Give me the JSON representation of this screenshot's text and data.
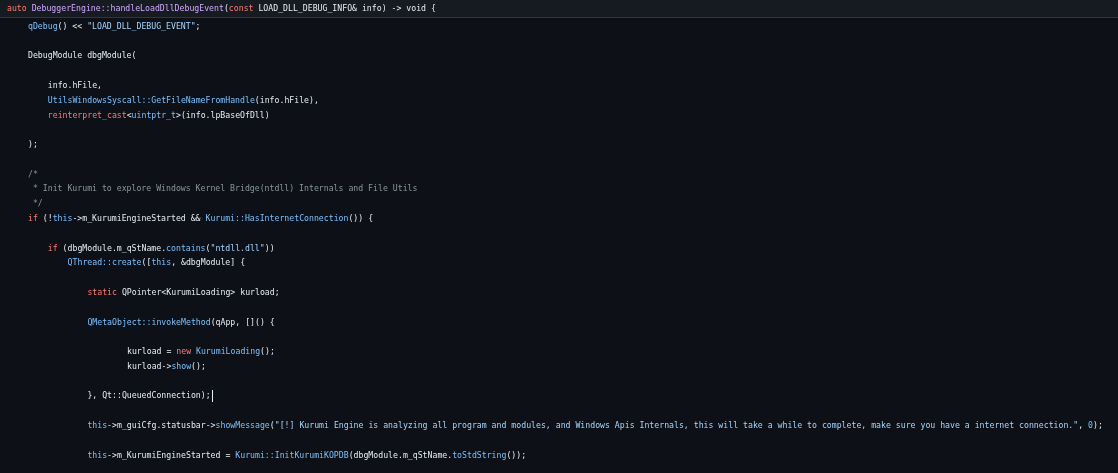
{
  "editor": {
    "header": {
      "tokens": [
        {
          "kind": "keyword",
          "text": "auto "
        },
        {
          "kind": "type",
          "text": "DebuggerEngine::handleLoadDllDebugEvent"
        },
        {
          "kind": "plain",
          "text": "("
        },
        {
          "kind": "keyword",
          "text": "const "
        },
        {
          "kind": "plain",
          "text": "LOAD_DLL_DEBUG_INFO& info) -> void {"
        }
      ]
    },
    "lines": [
      {
        "kind": "code",
        "tokens": [
          {
            "kind": "function",
            "text": "qDebug"
          },
          {
            "kind": "plain",
            "text": "() << "
          },
          {
            "kind": "string",
            "text": "\"LOAD_DLL_DEBUG_EVENT\""
          },
          {
            "kind": "plain",
            "text": ";"
          }
        ]
      },
      {
        "kind": "blank"
      },
      {
        "kind": "code",
        "tokens": [
          {
            "kind": "plain",
            "text": "DebugModule dbgModule("
          }
        ],
        "children": [
          {
            "kind": "blank"
          },
          {
            "kind": "code",
            "tokens": [
              {
                "kind": "plain",
                "text": "info.hFile,"
              }
            ]
          },
          {
            "kind": "code",
            "tokens": [
              {
                "kind": "function",
                "text": "UtilsWindowsSyscall::GetFileNameFromHandle"
              },
              {
                "kind": "plain",
                "text": "(info.hFile),"
              }
            ]
          },
          {
            "kind": "code",
            "tokens": [
              {
                "kind": "keyword",
                "text": "reinterpret_cast"
              },
              {
                "kind": "plain",
                "text": "<"
              },
              {
                "kind": "function",
                "text": "uintptr_t"
              },
              {
                "kind": "plain",
                "text": ">(info.lpBaseOfDll)"
              }
            ]
          },
          {
            "kind": "blank"
          }
        ]
      },
      {
        "kind": "code",
        "tokens": [
          {
            "kind": "plain",
            "text": ");"
          }
        ]
      },
      {
        "kind": "blank"
      },
      {
        "kind": "code",
        "tokens": [
          {
            "kind": "comment",
            "text": "/*"
          }
        ]
      },
      {
        "kind": "code",
        "tokens": [
          {
            "kind": "comment",
            "text": " * Init Kurumi to explore Windows Kernel Bridge(ntdll) Internals and File Utils"
          }
        ]
      },
      {
        "kind": "code",
        "tokens": [
          {
            "kind": "comment",
            "text": " */"
          }
        ]
      },
      {
        "kind": "code",
        "tokens": [
          {
            "kind": "keyword",
            "text": "if "
          },
          {
            "kind": "plain",
            "text": "(!"
          },
          {
            "kind": "function",
            "text": "this"
          },
          {
            "kind": "plain",
            "text": "->m_KurumiEngineStarted && "
          },
          {
            "kind": "function",
            "text": "Kurumi::HasInternetConnection"
          },
          {
            "kind": "plain",
            "text": "()) {"
          }
        ],
        "children": [
          {
            "kind": "blank"
          },
          {
            "kind": "code",
            "tokens": [
              {
                "kind": "keyword",
                "text": "if "
              },
              {
                "kind": "plain",
                "text": "(dbgModule.m_qStName."
              },
              {
                "kind": "function",
                "text": "contains"
              },
              {
                "kind": "plain",
                "text": "("
              },
              {
                "kind": "string",
                "text": "\"ntdll.dll\""
              },
              {
                "kind": "plain",
                "text": "))"
              }
            ],
            "children": [
              {
                "kind": "code",
                "tokens": [
                  {
                    "kind": "function",
                    "text": "QThread::create"
                  },
                  {
                    "kind": "plain",
                    "text": "(["
                  },
                  {
                    "kind": "function",
                    "text": "this"
                  },
                  {
                    "kind": "plain",
                    "text": ", &dbgModule] {"
                  }
                ],
                "children": [
                  {
                    "kind": "blank"
                  },
                  {
                    "kind": "code",
                    "tokens": [
                      {
                        "kind": "keyword",
                        "text": "static "
                      },
                      {
                        "kind": "plain",
                        "text": "QPointer<KurumiLoading> kurload;"
                      }
                    ]
                  },
                  {
                    "kind": "blank"
                  },
                  {
                    "kind": "code",
                    "tokens": [
                      {
                        "kind": "function",
                        "text": "QMetaObject::invokeMethod"
                      },
                      {
                        "kind": "plain",
                        "text": "(qApp, []() {"
                      }
                    ],
                    "children": [
                      {
                        "kind": "blank"
                      },
                      {
                        "kind": "group",
                        "children": [
                          {
                            "kind": "code",
                            "tokens": [
                              {
                                "kind": "plain",
                                "text": "kurload = "
                              },
                              {
                                "kind": "keyword",
                                "text": "new "
                              },
                              {
                                "kind": "function",
                                "text": "KurumiLoading"
                              },
                              {
                                "kind": "plain",
                                "text": "();"
                              }
                            ]
                          },
                          {
                            "kind": "code",
                            "tokens": [
                              {
                                "kind": "plain",
                                "text": "kurload->"
                              },
                              {
                                "kind": "function",
                                "text": "show"
                              },
                              {
                                "kind": "plain",
                                "text": "();"
                              }
                            ]
                          }
                        ]
                      },
                      {
                        "kind": "blank"
                      }
                    ]
                  },
                  {
                    "kind": "code",
                    "cursor": true,
                    "tokens": [
                      {
                        "kind": "plain",
                        "text": "}, Qt::QueuedConnection);"
                      }
                    ]
                  },
                  {
                    "kind": "blank"
                  },
                  {
                    "kind": "code",
                    "tokens": [
                      {
                        "kind": "function",
                        "text": "this"
                      },
                      {
                        "kind": "plain",
                        "text": "->m_guiCfg.statusbar->"
                      },
                      {
                        "kind": "function",
                        "text": "showMessage"
                      },
                      {
                        "kind": "plain",
                        "text": "("
                      },
                      {
                        "kind": "string",
                        "text": "\"[!] Kurumi Engine is analyzing all program and modules, and Windows Apis Internals, this will take a while to complete, make sure you have a internet connection.\""
                      },
                      {
                        "kind": "plain",
                        "text": ", "
                      },
                      {
                        "kind": "function",
                        "text": "0"
                      },
                      {
                        "kind": "plain",
                        "text": ");"
                      }
                    ]
                  },
                  {
                    "kind": "blank"
                  },
                  {
                    "kind": "code",
                    "tokens": [
                      {
                        "kind": "function",
                        "text": "this"
                      },
                      {
                        "kind": "plain",
                        "text": "->m_KurumiEngineStarted = "
                      },
                      {
                        "kind": "function",
                        "text": "Kurumi::InitKurumiKOPDB"
                      },
                      {
                        "kind": "plain",
                        "text": "(dbgModule.m_qStName."
                      },
                      {
                        "kind": "function",
                        "text": "toStdString"
                      },
                      {
                        "kind": "plain",
                        "text": "());"
                      }
                    ]
                  }
                ]
              }
            ]
          }
        ]
      }
    ]
  }
}
